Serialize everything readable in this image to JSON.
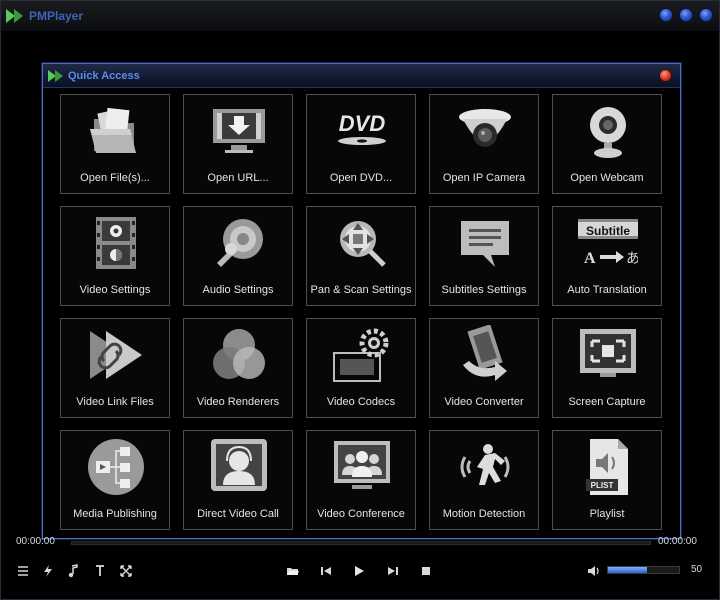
{
  "app": {
    "title": "PMPlayer"
  },
  "dialog": {
    "title": "Quick Access",
    "tiles": [
      {
        "label": "Open File(s)...",
        "icon": "folder-icon"
      },
      {
        "label": "Open URL...",
        "icon": "download-monitor-icon"
      },
      {
        "label": "Open DVD...",
        "icon": "dvd-icon"
      },
      {
        "label": "Open IP Camera",
        "icon": "ip-camera-icon"
      },
      {
        "label": "Open Webcam",
        "icon": "webcam-icon"
      },
      {
        "label": "Video Settings",
        "icon": "video-settings-icon"
      },
      {
        "label": "Audio Settings",
        "icon": "audio-settings-icon"
      },
      {
        "label": "Pan & Scan Settings",
        "icon": "pan-scan-icon"
      },
      {
        "label": "Subtitles Settings",
        "icon": "subtitles-icon"
      },
      {
        "label": "Auto Translation",
        "icon": "auto-translation-icon"
      },
      {
        "label": "Video Link Files",
        "icon": "video-link-icon"
      },
      {
        "label": "Video Renderers",
        "icon": "renderers-icon"
      },
      {
        "label": "Video Codecs",
        "icon": "codecs-icon"
      },
      {
        "label": "Video Converter",
        "icon": "converter-icon"
      },
      {
        "label": "Screen Capture",
        "icon": "screen-capture-icon"
      },
      {
        "label": "Media Publishing",
        "icon": "media-publishing-icon"
      },
      {
        "label": "Direct Video Call",
        "icon": "video-call-icon"
      },
      {
        "label": "Video Conference",
        "icon": "video-conference-icon"
      },
      {
        "label": "Motion Detection",
        "icon": "motion-detection-icon"
      },
      {
        "label": "Playlist",
        "icon": "playlist-icon"
      }
    ],
    "subtitle_icon_text": "Subtitle",
    "playlist_icon_text": "PLIST"
  },
  "player": {
    "time_elapsed": "00:00:00",
    "time_total": "00:00:00",
    "volume_value": "50",
    "volume_fraction": 0.55
  },
  "colors": {
    "accent": "#3f63b8",
    "tile_border": "#4d4f55",
    "dialog_border": "#4a6fc0"
  }
}
